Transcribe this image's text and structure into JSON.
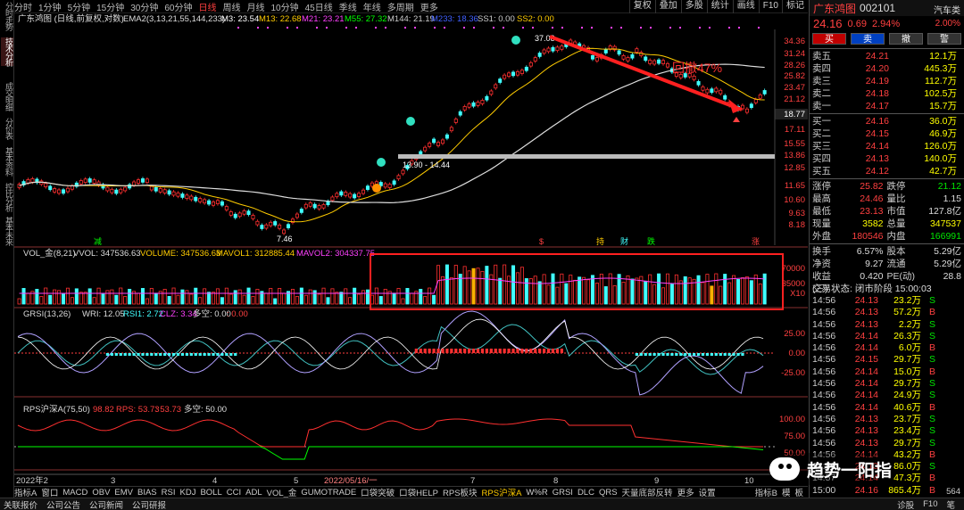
{
  "vtabs": [
    "分时走势",
    "技术分析",
    "成交明细",
    "分价表",
    "基本资料",
    "控比分析",
    "基本未来"
  ],
  "topbar": {
    "periods": [
      "分时",
      "1分钟",
      "5分钟",
      "15分钟",
      "30分钟",
      "60分钟",
      "日线",
      "周线",
      "月线",
      "10分钟",
      "45日线",
      "季线",
      "年线",
      "多周期",
      "更多"
    ],
    "active": "日线",
    "right": [
      "复权",
      "叠加",
      "多股",
      "统计",
      "画线",
      "F10",
      "标记"
    ]
  },
  "info": {
    "title": "广东鸿图 (日线,前复权,对数)",
    "ema": "EMA2(3,13,21,55,144,233)",
    "m3": "M3: 23.54",
    "m13": "M13: 22.68",
    "m21": "M21: 23.21",
    "m55": "M55: 27.32",
    "m144": "M144: 21.19",
    "m233": "M233: 18.36",
    "ss1": "SS1: 0.00",
    "ss2": "SS2: 0.00"
  },
  "price_axis": [
    "34.36",
    "31.24",
    "28.26",
    "25.82",
    "23.47",
    "21.12",
    "18.77",
    "17.11",
    "15.55",
    "13.86",
    "12.85",
    "11.65",
    "10.60",
    "9.63",
    "8.18"
  ],
  "price_highlight": "18.77",
  "annot": {
    "high": "37.08",
    "low": "7.46",
    "range": "13.90 - 14.44",
    "drawdown": "回撤47%"
  },
  "events": [
    "减",
    "$",
    "持",
    "财",
    "跌",
    "涨"
  ],
  "vol": {
    "title": "VOL_金(8,21)",
    "vvol": "VVOL: 347536.63",
    "volume": "VOLUME: 347536.63",
    "mavol1": "MAVOL1: 312885.44",
    "mavol2": "MAVOL2: 304337.75",
    "axis": [
      "70000",
      "35000",
      "X10"
    ]
  },
  "grsi": {
    "title": "GRSI(13,26)",
    "wri": "WRI: 12.05",
    "rsi1": "RSI1: 2.72",
    "clz": "CLZ: 3.34",
    "dk": "多空: 0.00",
    "dk2": ": 0.00",
    "axis": [
      "25.00",
      "0.00",
      "-25.00"
    ]
  },
  "rps": {
    "title": "RPS沪深A(75,50)",
    "a": "98.82",
    "b": "RPS: 53.73",
    "c": ": 53.73",
    "d": "多空: 50.00",
    "axis": [
      "100.00",
      "75.00",
      "50.00"
    ]
  },
  "dates": [
    "2022年2",
    "3",
    "4",
    "5",
    "2022/05/16/一",
    "7",
    "8",
    "9",
    "10"
  ],
  "bottom_tabs": [
    "指标A",
    "窗口",
    "MACD",
    "OBV",
    "EMV",
    "BIAS",
    "RSI",
    "KDJ",
    "BOLL",
    "CCI",
    "ADL",
    "VOL_金",
    "GUMOTRADE",
    "口袋突破",
    "口袋HELP",
    "RPS板块",
    "RPS沪深A",
    "W%R",
    "GRSI",
    "DLC",
    "QRS",
    "天量底部反转",
    "更多",
    "设置",
    "指标B",
    "模",
    "板"
  ],
  "bottom_active": "RPS沪深A",
  "status": [
    "关联报价",
    "公司公告",
    "公司新闻",
    "公司研报"
  ],
  "status_right": [
    "诊股",
    "F10",
    "笔"
  ],
  "right_panel": {
    "name": "广东鸿图",
    "code": "002101",
    "sector": "汽车类",
    "sector_chg": "2.00%",
    "price": "24.16",
    "chg": "0.69",
    "pct": "2.94%",
    "buttons": [
      "买",
      "卖",
      "撤",
      "警"
    ],
    "asks": [
      [
        "卖五",
        "24.21",
        "12.1万"
      ],
      [
        "卖四",
        "24.20",
        "445.3万"
      ],
      [
        "卖三",
        "24.19",
        "112.7万"
      ],
      [
        "卖二",
        "24.18",
        "102.5万"
      ],
      [
        "卖一",
        "24.17",
        "15.7万"
      ]
    ],
    "bids": [
      [
        "买一",
        "24.16",
        "36.0万"
      ],
      [
        "买二",
        "24.15",
        "46.9万"
      ],
      [
        "买三",
        "24.14",
        "126.0万"
      ],
      [
        "买四",
        "24.13",
        "140.0万"
      ],
      [
        "买五",
        "24.12",
        "42.7万"
      ]
    ],
    "stats": [
      [
        "涨停",
        "25.82",
        "跌停",
        "21.12"
      ],
      [
        "最高",
        "24.46",
        "量比",
        "1.15"
      ],
      [
        "最低",
        "23.13",
        "市值",
        "127.8亿"
      ],
      [
        "现量",
        "3582",
        "总量",
        "347537"
      ],
      [
        "外盘",
        "180546",
        "内盘",
        "166991"
      ]
    ],
    "stats2": [
      [
        "换手",
        "6.57%",
        "股本",
        "5.29亿"
      ],
      [
        "净资",
        "9.27",
        "流通",
        "5.29亿"
      ],
      [
        "收益(三)",
        "0.420",
        "PE(动)",
        "28.8"
      ]
    ],
    "status_line": "交易状态: 闭市阶段 15:00:03",
    "ticks": [
      [
        "14:56",
        "24.13",
        "23.2万",
        "S"
      ],
      [
        "14:56",
        "24.13",
        "57.2万",
        "B"
      ],
      [
        "14:56",
        "24.13",
        "2.2万",
        "S"
      ],
      [
        "14:56",
        "24.14",
        "26.3万",
        "S"
      ],
      [
        "14:56",
        "24.14",
        "6.0万",
        "B"
      ],
      [
        "14:56",
        "24.15",
        "29.7万",
        "S"
      ],
      [
        "14:56",
        "24.14",
        "15.0万",
        "B"
      ],
      [
        "14:56",
        "24.14",
        "29.7万",
        "S"
      ],
      [
        "14:56",
        "24.14",
        "24.9万",
        "S"
      ],
      [
        "14:56",
        "24.14",
        "40.6万",
        "B"
      ],
      [
        "14:56",
        "24.13",
        "23.7万",
        "S"
      ],
      [
        "14:56",
        "24.13",
        "23.4万",
        "S"
      ],
      [
        "14:56",
        "24.13",
        "29.7万",
        "S"
      ],
      [
        "14:56",
        "24.14",
        "43.2万",
        "B"
      ],
      [
        "14:56",
        "24.13",
        "86.0万",
        "S"
      ],
      [
        "14:57",
        "24.14",
        "47.3万",
        "B"
      ],
      [
        "15:00",
        "24.16",
        "865.4万",
        "B"
      ]
    ],
    "tick_count": "564"
  },
  "watermark": "趋势一阳指"
}
